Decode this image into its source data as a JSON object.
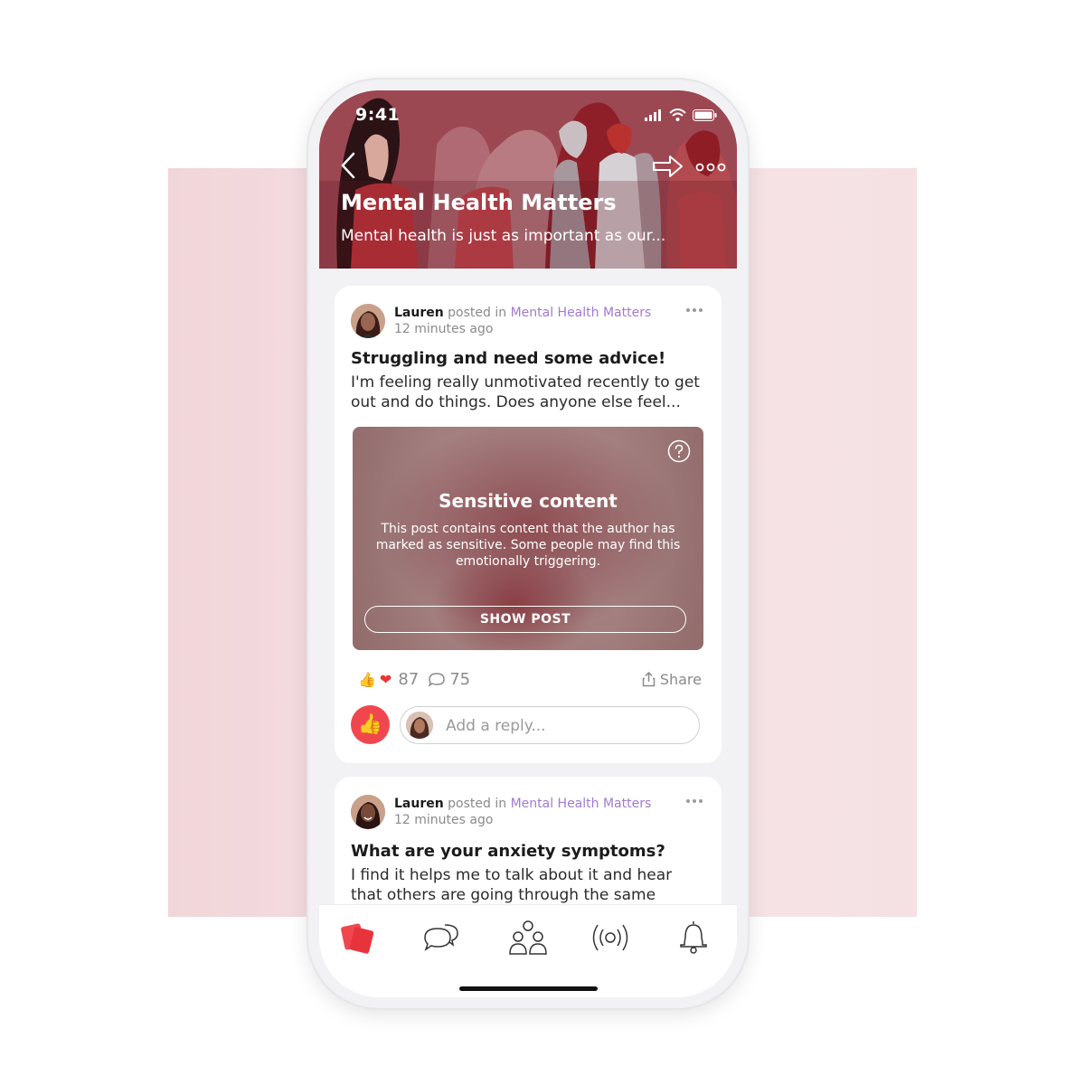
{
  "status_bar": {
    "time": "9:41"
  },
  "group": {
    "title": "Mental Health Matters",
    "description": "Mental health is just as important as our..."
  },
  "posts": [
    {
      "author": "Lauren",
      "posted_in": "posted in",
      "group": "Mental Health Matters",
      "time": "12 minutes ago",
      "title": "Struggling and need some advice!",
      "body": "I'm feeling really unmotivated recently to get out and do things. Does anyone else feel...",
      "sensitive": {
        "title": "Sensitive content",
        "text": "This post contains content that the author has marked as sensitive. Some people may find this emotionally triggering.",
        "button": "SHOW POST"
      },
      "reaction_count": "87",
      "comment_count": "75",
      "share_label": "Share",
      "reply_placeholder": "Add a reply..."
    },
    {
      "author": "Lauren",
      "posted_in": "posted in",
      "group": "Mental Health Matters",
      "time": "12 minutes ago",
      "title": "What are your anxiety symptoms?",
      "body": "I find it helps me to talk about it and hear that others are going through the same"
    }
  ],
  "tabs": [
    {
      "icon": "cards-icon",
      "active": true
    },
    {
      "icon": "chat-bubbles-icon",
      "active": false
    },
    {
      "icon": "community-icon",
      "active": false
    },
    {
      "icon": "broadcast-icon",
      "active": false
    },
    {
      "icon": "bell-icon",
      "active": false
    }
  ],
  "colors": {
    "accent": "#f0474f",
    "header": "#9a4550",
    "group_link": "#a17ad0",
    "backdrop": "#f5dfe2"
  }
}
